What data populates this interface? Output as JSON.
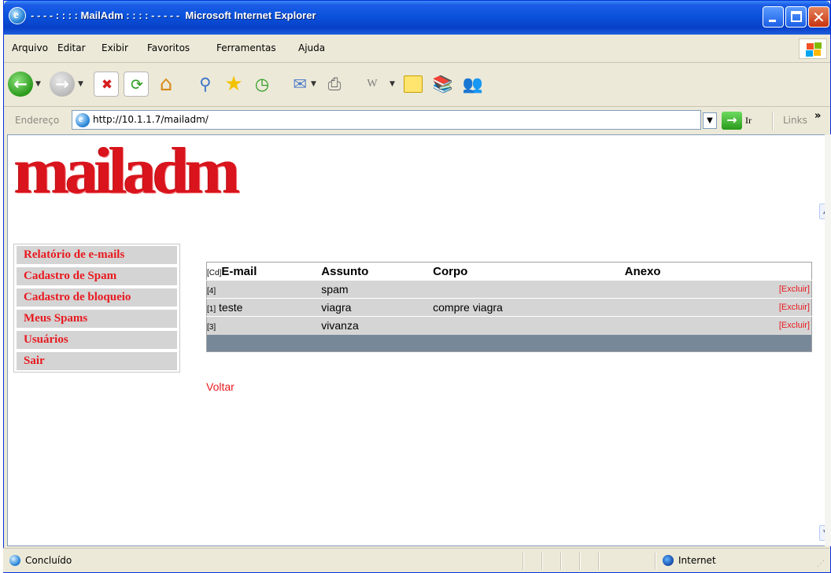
{
  "window": {
    "title": "- - - - : : : : MailAdm : : : : - - - - -  Microsoft Internet Explorer"
  },
  "menu": [
    "Arquivo",
    "Editar",
    "Exibir",
    "Favoritos",
    "Ferramentas",
    "Ajuda"
  ],
  "toolbar": {
    "icons": [
      "back-icon",
      "forward-icon",
      "stop-icon",
      "refresh-icon",
      "home-icon",
      "search-icon",
      "favorites-icon",
      "history-icon",
      "mail-icon",
      "print-icon",
      "edit-icon",
      "discuss-icon",
      "research-icon",
      "messenger-icon"
    ]
  },
  "address": {
    "label": "Endereço",
    "url": "http://10.1.1.7/mailadm/",
    "go_label": "Ir",
    "links_label": "Links",
    "links_chevron": "»"
  },
  "page": {
    "logo_text": "mailadm",
    "sidebar": [
      "Relatório de e-mails",
      "Cadastro de Spam",
      "Cadastro de bloqueio",
      "Meus Spams",
      "Usuários",
      "Sair"
    ],
    "table": {
      "cd_label": "[Cd]",
      "headers": [
        "E-mail",
        "Assunto",
        "Corpo",
        "Anexo"
      ],
      "rows": [
        {
          "idx": "[4]",
          "email": "",
          "assunto": "spam",
          "corpo": "",
          "anexo": "",
          "action": "[Excluir]"
        },
        {
          "idx": "[1]",
          "email": "teste",
          "assunto": "viagra",
          "corpo": "compre viagra",
          "anexo": "",
          "action": "[Excluir]"
        },
        {
          "idx": "[3]",
          "email": "",
          "assunto": "vivanza",
          "corpo": "",
          "anexo": "",
          "action": "[Excluir]"
        }
      ]
    },
    "back_link": "Voltar"
  },
  "status": {
    "text": "Concluído",
    "zone": "Internet"
  },
  "colors": {
    "accent_red": "#e8191f",
    "table_footer": "#778899",
    "row_bg": "#d5d5d5",
    "titlebar_blue": "#0a52dc"
  }
}
